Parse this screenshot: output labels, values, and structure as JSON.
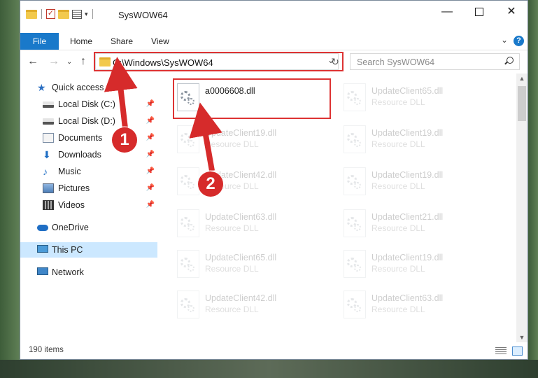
{
  "window": {
    "title": "SysWOW64"
  },
  "ribbon": {
    "tabs": [
      "File",
      "Home",
      "Share",
      "View"
    ]
  },
  "nav": {
    "address": "C:\\Windows\\SysWOW64",
    "search_placeholder": "Search SysWOW64"
  },
  "sidebar": {
    "items": [
      {
        "label": "Quick access",
        "icon": "star-icon"
      },
      {
        "label": "Local Disk (C:)",
        "icon": "drive-icon",
        "pinned": true
      },
      {
        "label": "Local Disk (D:)",
        "icon": "drive-icon",
        "pinned": true
      },
      {
        "label": "Documents",
        "icon": "documents-icon",
        "pinned": true
      },
      {
        "label": "Downloads",
        "icon": "download-icon",
        "pinned": true
      },
      {
        "label": "Music",
        "icon": "music-icon",
        "pinned": true
      },
      {
        "label": "Pictures",
        "icon": "pictures-icon",
        "pinned": true
      },
      {
        "label": "Videos",
        "icon": "videos-icon",
        "pinned": true
      },
      {
        "label": "OneDrive",
        "icon": "cloud-icon"
      },
      {
        "label": "This PC",
        "icon": "computer-icon",
        "selected": true
      },
      {
        "label": "Network",
        "icon": "network-icon"
      }
    ]
  },
  "files": [
    {
      "name": "a0006608.dll",
      "type": "",
      "highlighted": true
    },
    {
      "name": "UpdateClient65.dll",
      "type": "Resource DLL"
    },
    {
      "name": "UpdateClient19.dll",
      "type": "Resource DLL"
    },
    {
      "name": "UpdateClient19.dll",
      "type": "Resource DLL"
    },
    {
      "name": "UpdateClient42.dll",
      "type": "Resource DLL"
    },
    {
      "name": "UpdateClient19.dll",
      "type": "Resource DLL"
    },
    {
      "name": "UpdateClient63.dll",
      "type": "Resource DLL"
    },
    {
      "name": "UpdateClient21.dll",
      "type": "Resource DLL"
    },
    {
      "name": "UpdateClient65.dll",
      "type": "Resource DLL"
    },
    {
      "name": "UpdateClient19.dll",
      "type": "Resource DLL"
    },
    {
      "name": "UpdateClient42.dll",
      "type": "Resource DLL"
    },
    {
      "name": "UpdateClient63.dll",
      "type": "Resource DLL"
    }
  ],
  "status": {
    "item_count": "190 items"
  },
  "annotations": {
    "step1": "1",
    "step2": "2"
  },
  "colors": {
    "accent": "#1979ca",
    "highlight": "#d33333",
    "selected": "#cce8ff"
  }
}
